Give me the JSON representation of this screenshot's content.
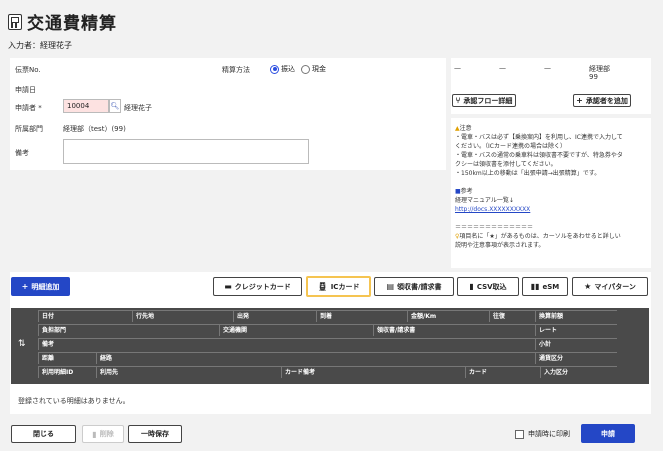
{
  "page": {
    "title": "交通費精算",
    "entrant": "入力者：経理花子"
  },
  "form": {
    "voucher_label": "伝票No.",
    "apply_date_label": "申請日",
    "applicant_label": "申請者 *",
    "applicant_code": "10004",
    "applicant_name": "経理花子",
    "dept_label": "所属部門",
    "dept_value": "経理部（test）(99)",
    "remarks_label": "備考",
    "settle_label": "精算方法",
    "settle_options": [
      "振込",
      "現金"
    ],
    "settle_selected": "振込"
  },
  "approval": {
    "cells": [
      "—",
      "—",
      "—"
    ],
    "final_dept": "経理部",
    "final_code": "99",
    "flow_button": "承認フロー詳細",
    "add_approver_button": "承認者を追加"
  },
  "notes": {
    "caution_title": "注意",
    "lines": [
      "・電車・バスは必ず【乗換案内】を利用し、IC連携で入力して",
      "ください。（ICカード連携の場合は除く）",
      "・電車・バスの通常の乗車料は領収書不要ですが、特急券やタ",
      "クシーは領収書を添付してください。",
      "・150km以上の移動は「出張申請→出張精算」です。"
    ],
    "ref_title": "参考",
    "ref_text": "経理マニュアル一覧↓",
    "ref_link": "http://docs.XXXXXXXXXX",
    "separator": "＝＝＝＝＝＝＝＝＝＝＝＝＝",
    "tip": "項目名に「★」があるものは、カーソルをあわせると詳しい",
    "tip2": "説明や注意事項が表示されます。"
  },
  "toolbar": {
    "add_detail": "明細追加",
    "credit_card": "クレジットカード",
    "ic_card": "ICカード",
    "receipt": "領収書/請求書",
    "csv": "CSV取込",
    "esm": "eSM",
    "my_pattern": "マイパターン"
  },
  "table": {
    "row1": [
      "日付",
      "行先地",
      "出発",
      "到着",
      "金額/Km",
      "往復",
      "換算前額"
    ],
    "row2": [
      "負担部門",
      "交通機関",
      "領収書/請求書",
      "レート"
    ],
    "row3": [
      "備考",
      "小計"
    ],
    "row4": [
      "距離",
      "経路",
      "通貨区分"
    ],
    "row5": [
      "利用明細ID",
      "利用先",
      "カード備考",
      "カード",
      "入力区分"
    ],
    "empty_message": "登録されている明細はありません。"
  },
  "footer": {
    "close": "閉じる",
    "delete": "削除",
    "temp_save": "一時保存",
    "print_on_apply": "申請時に印刷",
    "apply": "申請"
  },
  "colors": {
    "accent": "#2447c6",
    "required_bg": "#fde2e1",
    "table_header": "#4a4a4a",
    "highlight": "#f5c451"
  }
}
